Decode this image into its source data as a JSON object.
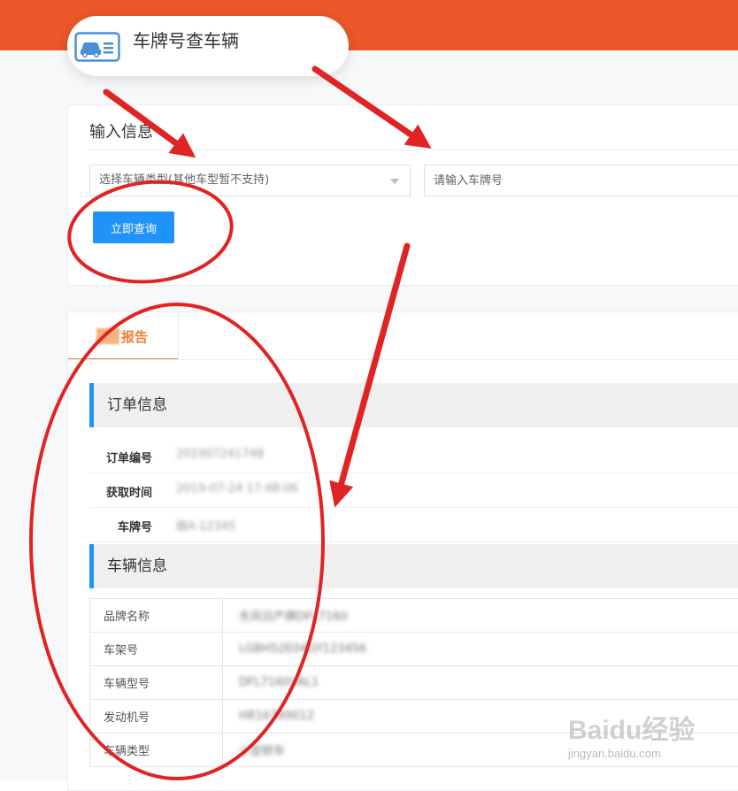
{
  "header": {
    "title": "车牌号查车辆",
    "icon": "car-license-icon",
    "bar_color": "#e9572a"
  },
  "query": {
    "section_title": "输入信息",
    "vehicle_type_select": {
      "value": "选择车辆类型(其他车型暂不支持)"
    },
    "plate_input": {
      "placeholder": "请输入车牌号",
      "value": ""
    },
    "submit_label": "立即查询",
    "accent": "#1f93f9"
  },
  "report": {
    "tab_label": "报告",
    "order_section_title": "订单信息",
    "order_fields": [
      {
        "label": "订单编号",
        "value": "201907241748"
      },
      {
        "label": "获取时间",
        "value": "2019-07-24 17:48:06"
      },
      {
        "label": "车牌号",
        "value": "赣A·12345"
      }
    ],
    "vehicle_section_title": "车辆信息",
    "vehicle_fields": [
      {
        "label": "品牌名称",
        "value": "东风日产牌DFL7160"
      },
      {
        "label": "车架号",
        "value": "LGBH52E04GY123456"
      },
      {
        "label": "车辆型号",
        "value": "DFL7160VAL1"
      },
      {
        "label": "发动机号",
        "value": "HR16789012"
      },
      {
        "label": "车辆类型",
        "value": "小型轿车"
      }
    ]
  },
  "watermark": {
    "logo": "Baidu经验",
    "url": "jingyan.baidu.com"
  }
}
